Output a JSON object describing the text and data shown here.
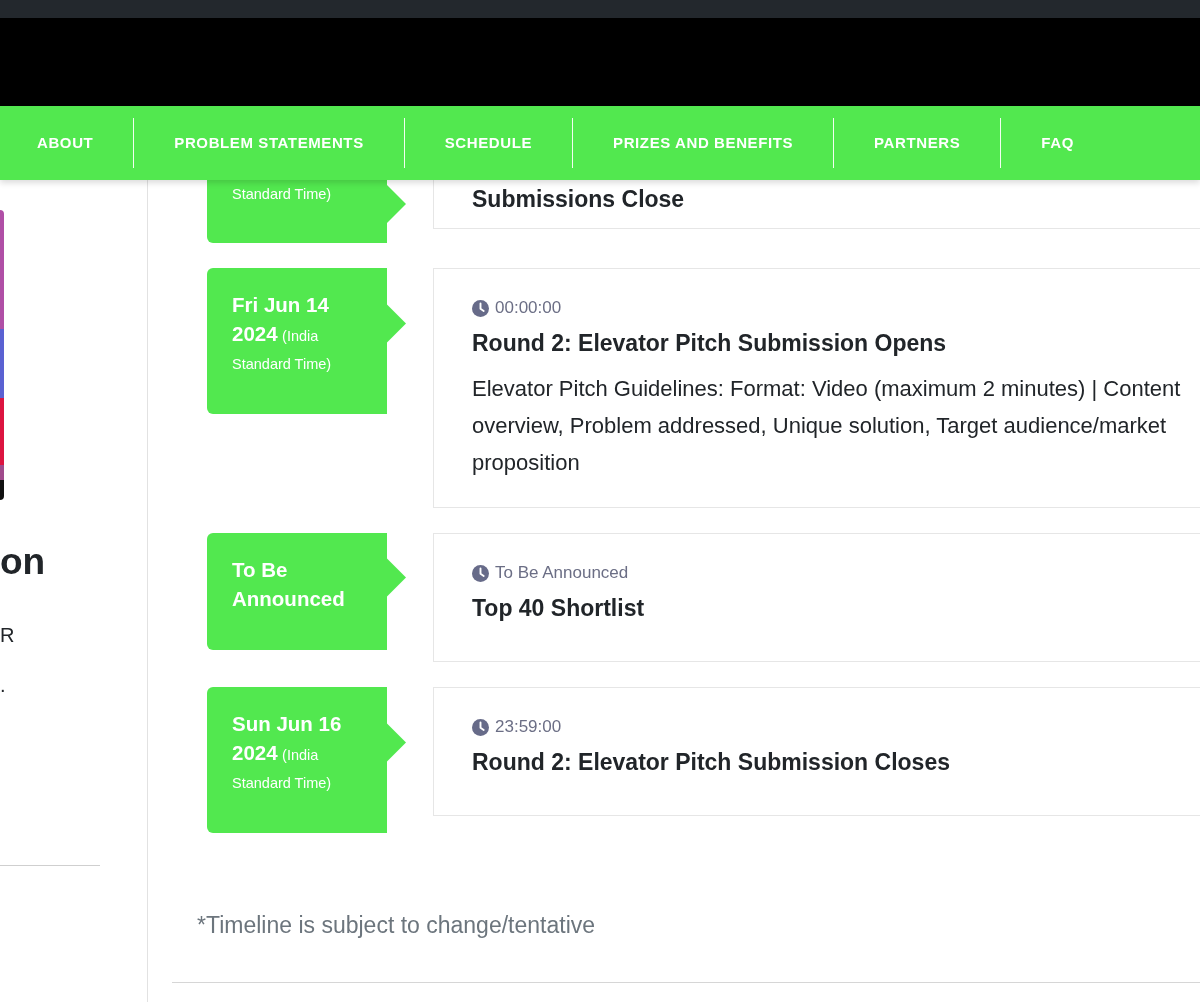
{
  "nav": [
    "ABOUT",
    "PROBLEM STATEMENTS",
    "SCHEDULE",
    "PRIZES AND BENEFITS",
    "PARTNERS",
    "FAQ"
  ],
  "sidebar": {
    "heading": "on",
    "lines": [
      "R",
      "."
    ]
  },
  "timeline": {
    "items": [
      {
        "kind": "partial",
        "date_tail": "Standard Time)",
        "title": "Submissions Close"
      },
      {
        "kind": "full",
        "date": "Fri Jun 14 2024",
        "timezone": "(India Standard Time)",
        "time": "00:00:00",
        "title": "Round 2: Elevator Pitch Submission Opens",
        "description": [
          "Elevator Pitch Guidelines: Format: Video (maximum 2 minutes) | Content",
          "overview, Problem addressed, Unique solution, Target audience/market",
          "proposition"
        ]
      },
      {
        "kind": "full",
        "date": "To Be Announced",
        "time": "To Be Announced",
        "title": "Top 40 Shortlist"
      },
      {
        "kind": "full",
        "date": "Sun Jun 16 2024",
        "timezone": "(India Standard Time)",
        "time": "23:59:00",
        "title": "Round 2: Elevator Pitch Submission Closes"
      }
    ],
    "note": "*Timeline is subject to change/tentative"
  }
}
